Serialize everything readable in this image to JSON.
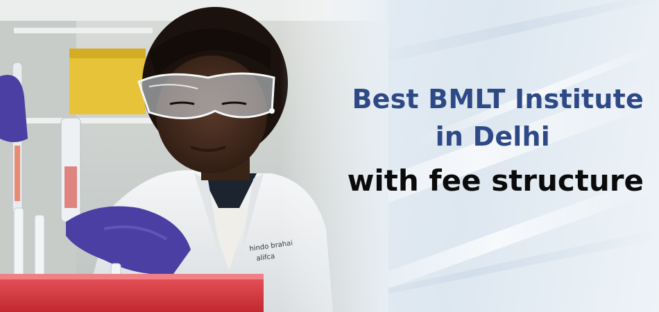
{
  "banner": {
    "headline": {
      "line1": "Best BMLT Institute",
      "line2": "in Delhi",
      "line3": "with fee structure"
    },
    "photo": {
      "subject": "lab-technician",
      "coat_text": "—"
    },
    "colors": {
      "headline_blue": "#2e4a86",
      "headline_black": "#0b0b0b",
      "background": "#e6eef5",
      "glove_purple": "#4b3fa3"
    }
  }
}
